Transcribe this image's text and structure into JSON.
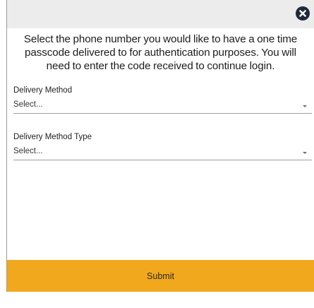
{
  "dialog": {
    "close_icon": "close-circle-icon",
    "intro_text": "Select the phone number you would like to have a one time\npasscode delivered to for authentication purposes. You will\nneed to enter the code received to continue login.",
    "delivery_method": {
      "label": "Delivery Method",
      "value": "Select..."
    },
    "delivery_method_type": {
      "label": "Delivery Method Type",
      "value": "Select..."
    },
    "submit_label": "Submit"
  },
  "colors": {
    "header_bg": "#ececec",
    "close_icon": "#1e2a3a",
    "submit_bg": "#f2a81d"
  }
}
